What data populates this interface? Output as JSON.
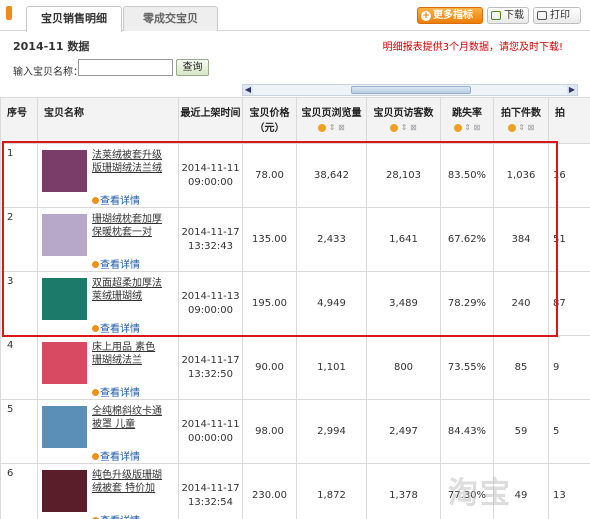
{
  "tabs": [
    {
      "label": "宝贝销售明细",
      "active": true
    },
    {
      "label": "零成交宝贝",
      "active": false
    }
  ],
  "toolbar": {
    "more_metrics": "更多指标",
    "download": "下载",
    "print": "打印"
  },
  "period_title": "2014-11 数据",
  "notice": "明细报表提供3个月数据，请您及时下载!",
  "search": {
    "label": "输入宝贝名称：",
    "value": "",
    "button": "查询"
  },
  "table": {
    "headers": {
      "seq": "序号",
      "name": "宝贝名称",
      "listed_time": "最近上架时间",
      "price": "宝贝价格（元）",
      "page_views": "宝贝页浏览量",
      "visitors": "宝贝页访客数",
      "bounce_rate": "跳失率",
      "order_qty": "拍下件数",
      "extra": "拍"
    },
    "sort_icons": "❓⇕⊠",
    "detail_link": "查看详情",
    "rows": [
      {
        "seq": "1",
        "name": "法莱绒被套升级版珊瑚绒法兰绒",
        "date": "2014-11-11",
        "time": "09:00:00",
        "price": "78.00",
        "pv": "38,642",
        "uv": "28,103",
        "bounce": "83.50%",
        "qty": "1,036",
        "extra": "16"
      },
      {
        "seq": "2",
        "name": "珊瑚绒枕套加厚保暖枕套一对",
        "date": "2014-11-17",
        "time": "13:32:43",
        "price": "135.00",
        "pv": "2,433",
        "uv": "1,641",
        "bounce": "67.62%",
        "qty": "384",
        "extra": "51"
      },
      {
        "seq": "3",
        "name": "双面超柔加厚法莱绒珊瑚绒",
        "date": "2014-11-13",
        "time": "09:00:00",
        "price": "195.00",
        "pv": "4,949",
        "uv": "3,489",
        "bounce": "78.29%",
        "qty": "240",
        "extra": "87"
      },
      {
        "seq": "4",
        "name": "床上用品 素色珊瑚绒法兰",
        "date": "2014-11-17",
        "time": "13:32:50",
        "price": "90.00",
        "pv": "1,101",
        "uv": "800",
        "bounce": "73.55%",
        "qty": "85",
        "extra": "9"
      },
      {
        "seq": "5",
        "name": "全纯棉斜纹卡通被罩 儿童",
        "date": "2014-11-11",
        "time": "00:00:00",
        "price": "98.00",
        "pv": "2,994",
        "uv": "2,497",
        "bounce": "84.43%",
        "qty": "59",
        "extra": "5"
      },
      {
        "seq": "6",
        "name": "纯色升级版珊瑚绒被套 特价加",
        "date": "2014-11-17",
        "time": "13:32:54",
        "price": "230.00",
        "pv": "1,872",
        "uv": "1,378",
        "bounce": "77.30%",
        "qty": "49",
        "extra": "13"
      }
    ]
  },
  "thumb_colors": [
    "#7a3d6a",
    "#b7a7c9",
    "#1c7a6a",
    "#d84a62",
    "#5c8fb8",
    "#5a1d2a"
  ]
}
